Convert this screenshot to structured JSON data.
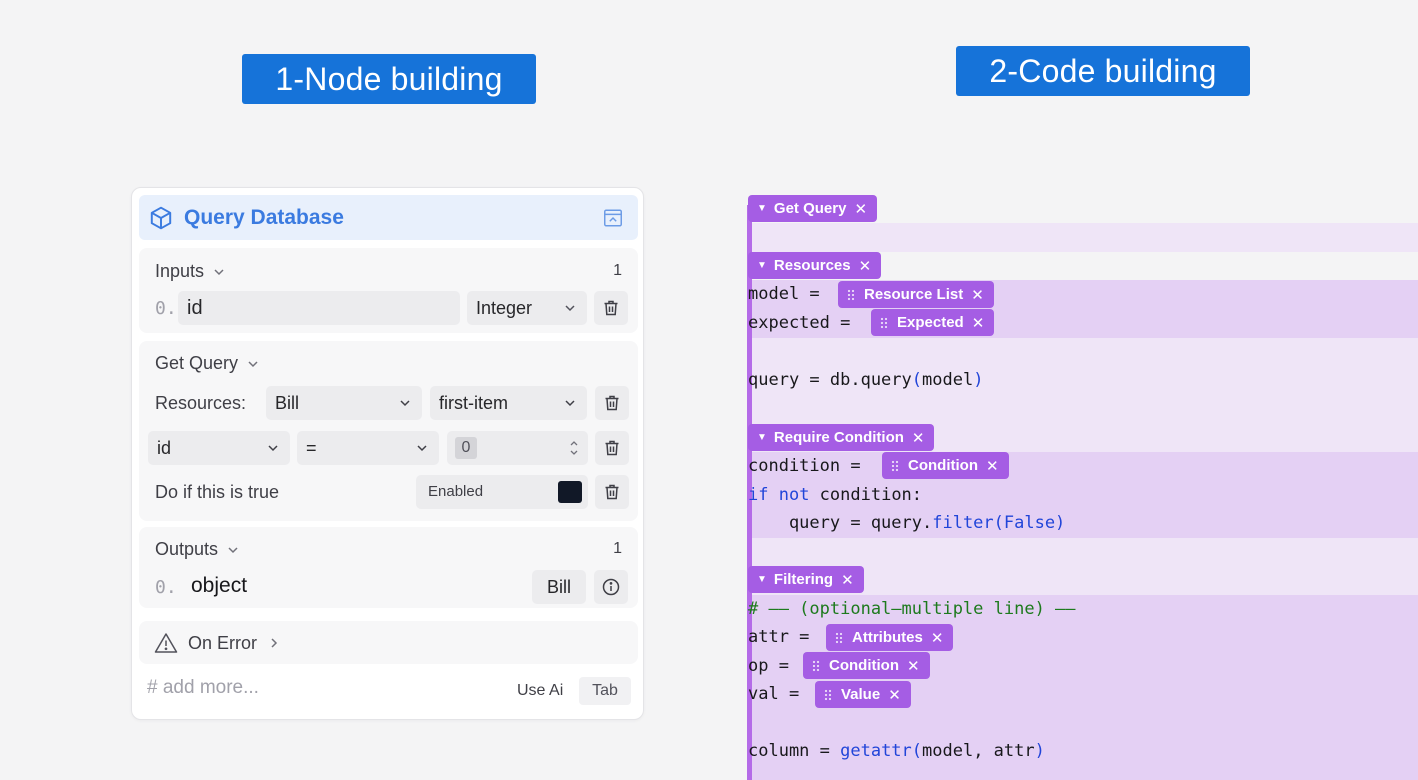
{
  "banners": {
    "node": "1-Node building",
    "code": "2-Code building"
  },
  "node": {
    "title": "Query Database",
    "inputs": {
      "label": "Inputs",
      "count": "1",
      "row": {
        "index": "0.",
        "name": "id",
        "type": "Integer"
      }
    },
    "get_query": {
      "label": "Get Query",
      "resources_label": "Resources:",
      "resource": "Bill",
      "mode": "first-item",
      "filter": {
        "field": "id",
        "operator": "=",
        "value": "0"
      },
      "condition_label": "Do if this is true",
      "condition_value": "Enabled"
    },
    "outputs": {
      "label": "Outputs",
      "count": "1",
      "row": {
        "index": "0.",
        "name": "object",
        "type": "Bill"
      }
    },
    "on_error": "On Error",
    "add_more_placeholder": "# add more...",
    "use_ai": "Use Ai",
    "tab_key": "Tab"
  },
  "code": {
    "tags": {
      "get_query": "Get Query",
      "resources": "Resources",
      "resource_list": "Resource List",
      "expected": "Expected",
      "require_condition": "Require Condition",
      "condition": "Condition",
      "filtering": "Filtering",
      "attributes": "Attributes",
      "condition2": "Condition",
      "value": "Value"
    },
    "lines": {
      "model": "model = ",
      "expected": "expected = ",
      "query_a": "query = db.query",
      "query_b": "(",
      "query_c": "model",
      "query_d": ")",
      "condition": "condition = ",
      "if_kw": "if",
      "not_kw": " not",
      "if_rest": " condition:",
      "filter_a": "    query = query.",
      "filter_b": "filter(False)",
      "comment": "# —— (optional—multiple line) ——",
      "attr": "attr = ",
      "op": "op = ",
      "val": "val = ",
      "column_a": "column = ",
      "column_b": "getattr(",
      "column_c": "model, attr",
      "column_d": ")"
    }
  },
  "colors": {
    "banner": "#1673d9",
    "tag": "#a55de4",
    "node_title": "#3b7be0"
  }
}
